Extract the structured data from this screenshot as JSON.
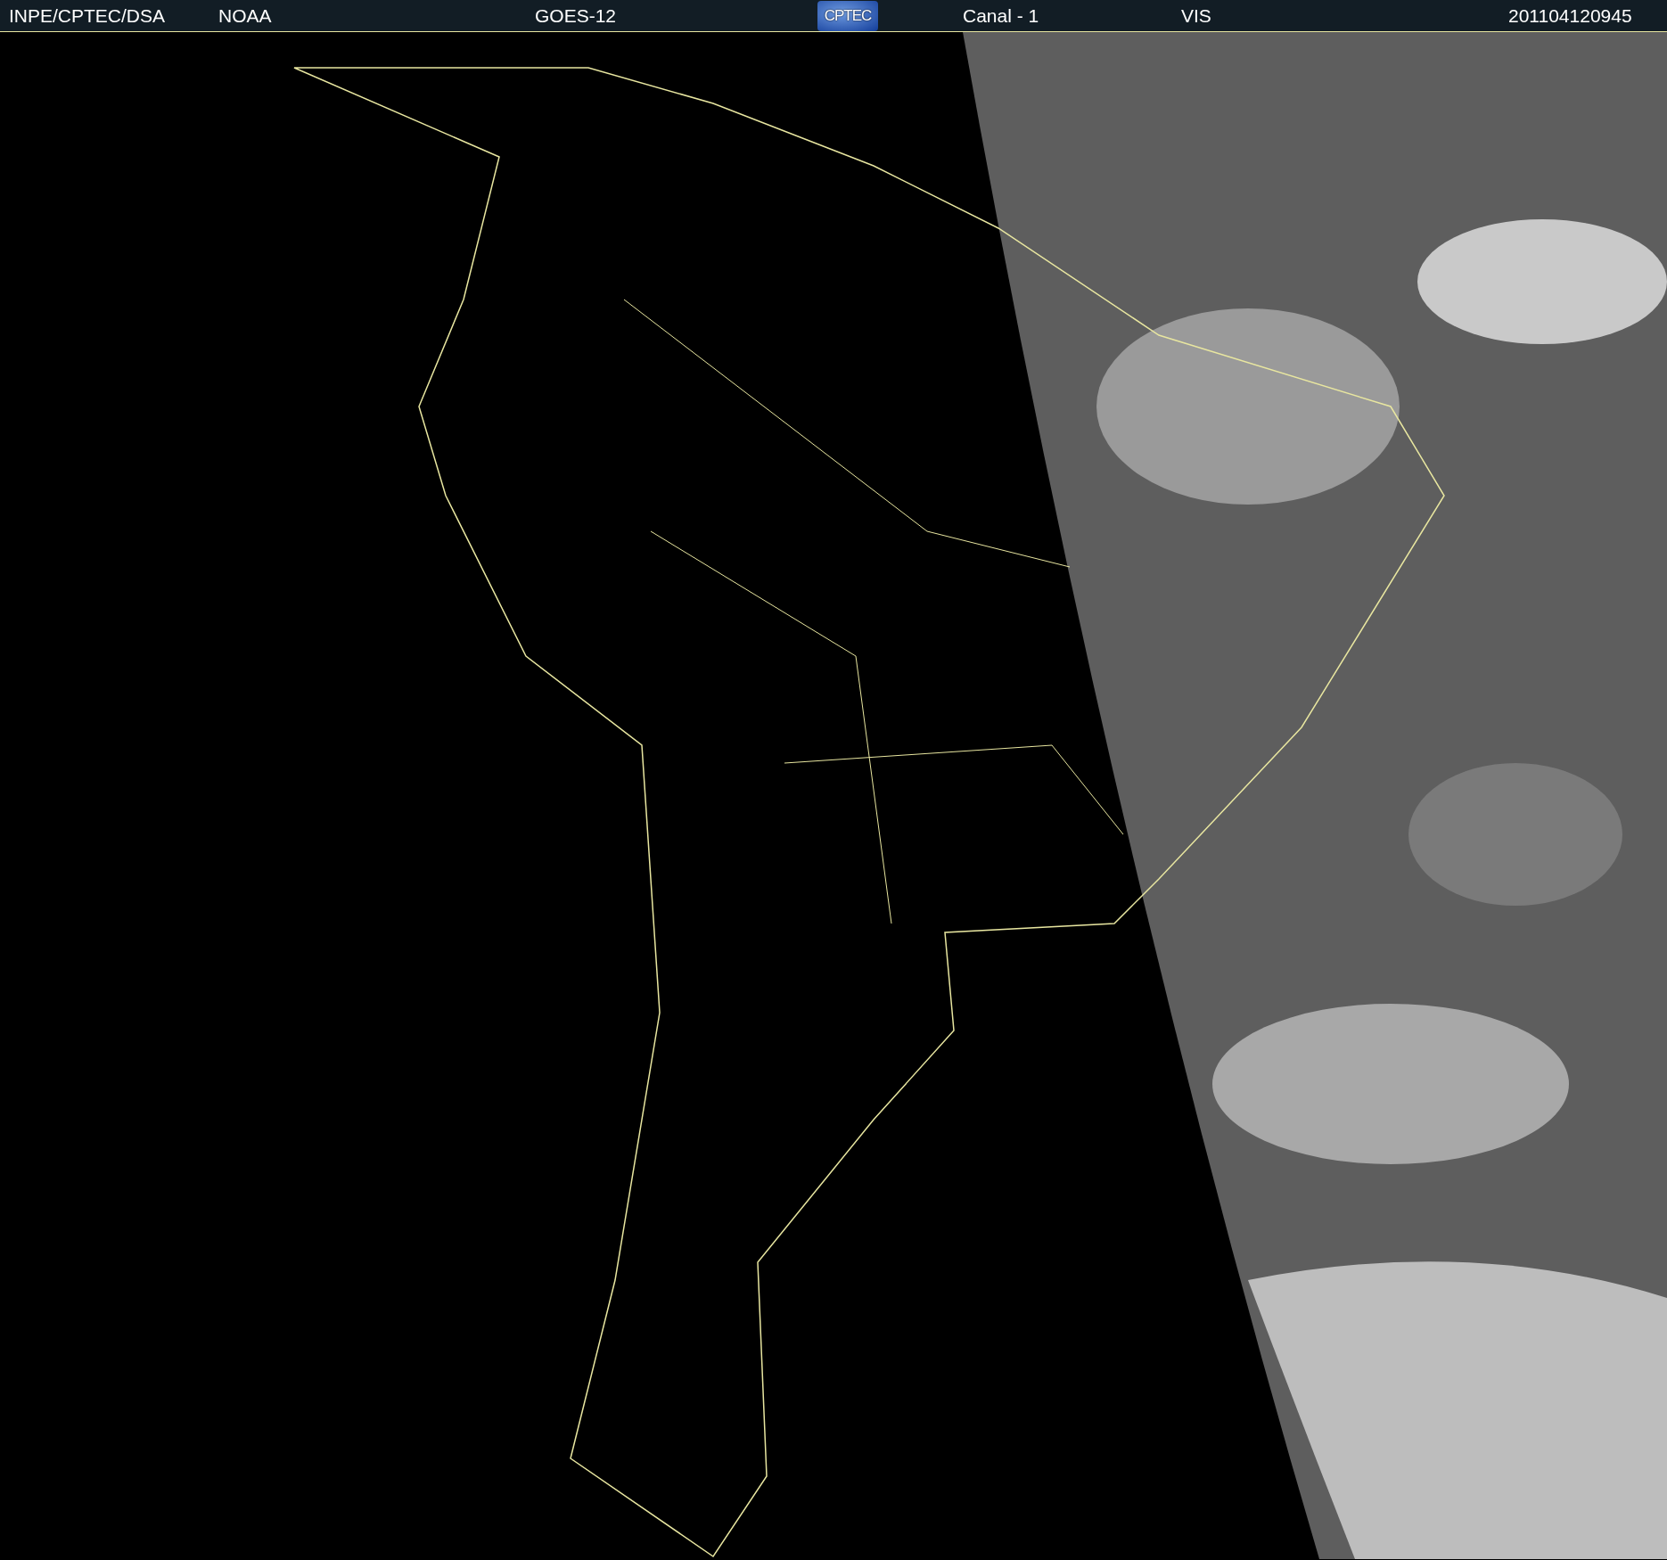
{
  "header": {
    "source": "INPE/CPTEC/DSA",
    "agency": "NOAA",
    "satellite": "GOES-12",
    "logo": "CPTEC",
    "channel": "Canal - 1",
    "band": "VIS",
    "timestamp": "201104120945"
  }
}
